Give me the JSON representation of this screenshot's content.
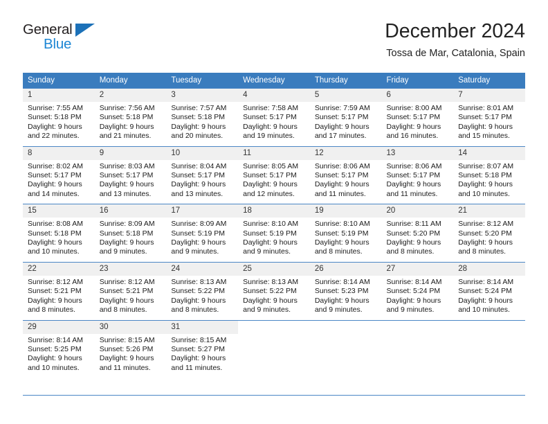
{
  "brand": {
    "name_part1": "General",
    "name_part2": "Blue",
    "triangle_icon": "blue-triangle-icon",
    "color_dark": "#231f20",
    "color_blue": "#1c86d4"
  },
  "header": {
    "title": "December 2024",
    "subtitle": "Tossa de Mar, Catalonia, Spain"
  },
  "theme": {
    "header_bg": "#3a7cbe",
    "header_text": "#ffffff",
    "row_border": "#4a86c5",
    "daynum_bg": "#f0f0f0"
  },
  "weekday_headers": [
    "Sunday",
    "Monday",
    "Tuesday",
    "Wednesday",
    "Thursday",
    "Friday",
    "Saturday"
  ],
  "weeks": [
    {
      "days": [
        {
          "num": "1",
          "sunrise": "Sunrise: 7:55 AM",
          "sunset": "Sunset: 5:18 PM",
          "daylight1": "Daylight: 9 hours",
          "daylight2": "and 22 minutes."
        },
        {
          "num": "2",
          "sunrise": "Sunrise: 7:56 AM",
          "sunset": "Sunset: 5:18 PM",
          "daylight1": "Daylight: 9 hours",
          "daylight2": "and 21 minutes."
        },
        {
          "num": "3",
          "sunrise": "Sunrise: 7:57 AM",
          "sunset": "Sunset: 5:18 PM",
          "daylight1": "Daylight: 9 hours",
          "daylight2": "and 20 minutes."
        },
        {
          "num": "4",
          "sunrise": "Sunrise: 7:58 AM",
          "sunset": "Sunset: 5:17 PM",
          "daylight1": "Daylight: 9 hours",
          "daylight2": "and 19 minutes."
        },
        {
          "num": "5",
          "sunrise": "Sunrise: 7:59 AM",
          "sunset": "Sunset: 5:17 PM",
          "daylight1": "Daylight: 9 hours",
          "daylight2": "and 17 minutes."
        },
        {
          "num": "6",
          "sunrise": "Sunrise: 8:00 AM",
          "sunset": "Sunset: 5:17 PM",
          "daylight1": "Daylight: 9 hours",
          "daylight2": "and 16 minutes."
        },
        {
          "num": "7",
          "sunrise": "Sunrise: 8:01 AM",
          "sunset": "Sunset: 5:17 PM",
          "daylight1": "Daylight: 9 hours",
          "daylight2": "and 15 minutes."
        }
      ]
    },
    {
      "days": [
        {
          "num": "8",
          "sunrise": "Sunrise: 8:02 AM",
          "sunset": "Sunset: 5:17 PM",
          "daylight1": "Daylight: 9 hours",
          "daylight2": "and 14 minutes."
        },
        {
          "num": "9",
          "sunrise": "Sunrise: 8:03 AM",
          "sunset": "Sunset: 5:17 PM",
          "daylight1": "Daylight: 9 hours",
          "daylight2": "and 13 minutes."
        },
        {
          "num": "10",
          "sunrise": "Sunrise: 8:04 AM",
          "sunset": "Sunset: 5:17 PM",
          "daylight1": "Daylight: 9 hours",
          "daylight2": "and 13 minutes."
        },
        {
          "num": "11",
          "sunrise": "Sunrise: 8:05 AM",
          "sunset": "Sunset: 5:17 PM",
          "daylight1": "Daylight: 9 hours",
          "daylight2": "and 12 minutes."
        },
        {
          "num": "12",
          "sunrise": "Sunrise: 8:06 AM",
          "sunset": "Sunset: 5:17 PM",
          "daylight1": "Daylight: 9 hours",
          "daylight2": "and 11 minutes."
        },
        {
          "num": "13",
          "sunrise": "Sunrise: 8:06 AM",
          "sunset": "Sunset: 5:17 PM",
          "daylight1": "Daylight: 9 hours",
          "daylight2": "and 11 minutes."
        },
        {
          "num": "14",
          "sunrise": "Sunrise: 8:07 AM",
          "sunset": "Sunset: 5:18 PM",
          "daylight1": "Daylight: 9 hours",
          "daylight2": "and 10 minutes."
        }
      ]
    },
    {
      "days": [
        {
          "num": "15",
          "sunrise": "Sunrise: 8:08 AM",
          "sunset": "Sunset: 5:18 PM",
          "daylight1": "Daylight: 9 hours",
          "daylight2": "and 10 minutes."
        },
        {
          "num": "16",
          "sunrise": "Sunrise: 8:09 AM",
          "sunset": "Sunset: 5:18 PM",
          "daylight1": "Daylight: 9 hours",
          "daylight2": "and 9 minutes."
        },
        {
          "num": "17",
          "sunrise": "Sunrise: 8:09 AM",
          "sunset": "Sunset: 5:19 PM",
          "daylight1": "Daylight: 9 hours",
          "daylight2": "and 9 minutes."
        },
        {
          "num": "18",
          "sunrise": "Sunrise: 8:10 AM",
          "sunset": "Sunset: 5:19 PM",
          "daylight1": "Daylight: 9 hours",
          "daylight2": "and 9 minutes."
        },
        {
          "num": "19",
          "sunrise": "Sunrise: 8:10 AM",
          "sunset": "Sunset: 5:19 PM",
          "daylight1": "Daylight: 9 hours",
          "daylight2": "and 8 minutes."
        },
        {
          "num": "20",
          "sunrise": "Sunrise: 8:11 AM",
          "sunset": "Sunset: 5:20 PM",
          "daylight1": "Daylight: 9 hours",
          "daylight2": "and 8 minutes."
        },
        {
          "num": "21",
          "sunrise": "Sunrise: 8:12 AM",
          "sunset": "Sunset: 5:20 PM",
          "daylight1": "Daylight: 9 hours",
          "daylight2": "and 8 minutes."
        }
      ]
    },
    {
      "days": [
        {
          "num": "22",
          "sunrise": "Sunrise: 8:12 AM",
          "sunset": "Sunset: 5:21 PM",
          "daylight1": "Daylight: 9 hours",
          "daylight2": "and 8 minutes."
        },
        {
          "num": "23",
          "sunrise": "Sunrise: 8:12 AM",
          "sunset": "Sunset: 5:21 PM",
          "daylight1": "Daylight: 9 hours",
          "daylight2": "and 8 minutes."
        },
        {
          "num": "24",
          "sunrise": "Sunrise: 8:13 AM",
          "sunset": "Sunset: 5:22 PM",
          "daylight1": "Daylight: 9 hours",
          "daylight2": "and 8 minutes."
        },
        {
          "num": "25",
          "sunrise": "Sunrise: 8:13 AM",
          "sunset": "Sunset: 5:22 PM",
          "daylight1": "Daylight: 9 hours",
          "daylight2": "and 9 minutes."
        },
        {
          "num": "26",
          "sunrise": "Sunrise: 8:14 AM",
          "sunset": "Sunset: 5:23 PM",
          "daylight1": "Daylight: 9 hours",
          "daylight2": "and 9 minutes."
        },
        {
          "num": "27",
          "sunrise": "Sunrise: 8:14 AM",
          "sunset": "Sunset: 5:24 PM",
          "daylight1": "Daylight: 9 hours",
          "daylight2": "and 9 minutes."
        },
        {
          "num": "28",
          "sunrise": "Sunrise: 8:14 AM",
          "sunset": "Sunset: 5:24 PM",
          "daylight1": "Daylight: 9 hours",
          "daylight2": "and 10 minutes."
        }
      ]
    },
    {
      "days": [
        {
          "num": "29",
          "sunrise": "Sunrise: 8:14 AM",
          "sunset": "Sunset: 5:25 PM",
          "daylight1": "Daylight: 9 hours",
          "daylight2": "and 10 minutes."
        },
        {
          "num": "30",
          "sunrise": "Sunrise: 8:15 AM",
          "sunset": "Sunset: 5:26 PM",
          "daylight1": "Daylight: 9 hours",
          "daylight2": "and 11 minutes."
        },
        {
          "num": "31",
          "sunrise": "Sunrise: 8:15 AM",
          "sunset": "Sunset: 5:27 PM",
          "daylight1": "Daylight: 9 hours",
          "daylight2": "and 11 minutes."
        },
        {
          "num": "",
          "sunrise": "",
          "sunset": "",
          "daylight1": "",
          "daylight2": ""
        },
        {
          "num": "",
          "sunrise": "",
          "sunset": "",
          "daylight1": "",
          "daylight2": ""
        },
        {
          "num": "",
          "sunrise": "",
          "sunset": "",
          "daylight1": "",
          "daylight2": ""
        },
        {
          "num": "",
          "sunrise": "",
          "sunset": "",
          "daylight1": "",
          "daylight2": ""
        }
      ]
    }
  ]
}
